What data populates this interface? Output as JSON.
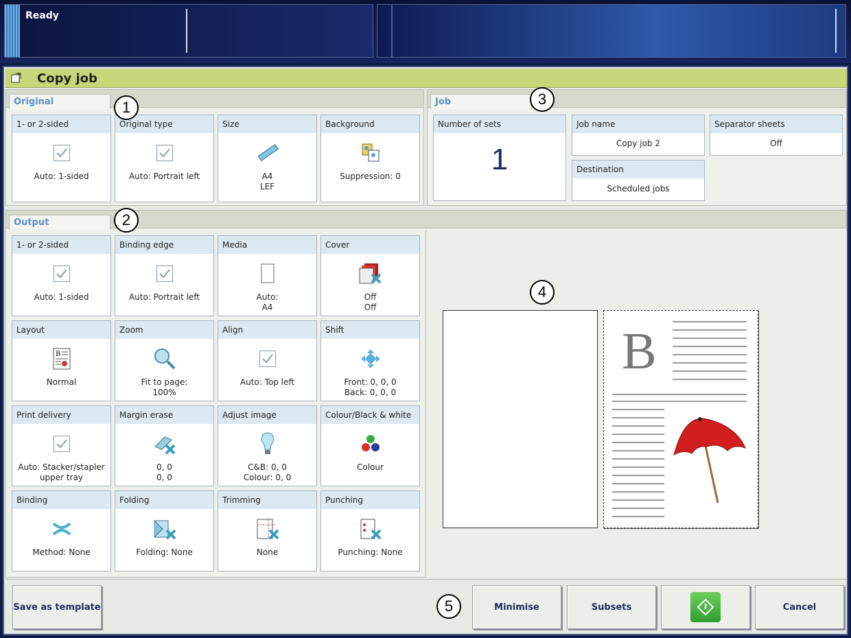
{
  "status": {
    "text": "Ready"
  },
  "window": {
    "title": "Copy job"
  },
  "original": {
    "tab": "Original",
    "tiles": [
      {
        "label": "1- or 2-sided",
        "icon": "checkbox-icon",
        "value": "Auto: 1-sided"
      },
      {
        "label": "Original type",
        "icon": "checkbox-icon",
        "value": "Auto: Portrait left"
      },
      {
        "label": "Size",
        "icon": "ruler-icon",
        "value": "A4\nLEF"
      },
      {
        "label": "Background",
        "icon": "background-suppression-icon",
        "value": "Suppression: 0"
      }
    ]
  },
  "job": {
    "tab": "Job",
    "sets": {
      "label": "Number of sets",
      "value": "1"
    },
    "name": {
      "label": "Job name",
      "value": "Copy job 2"
    },
    "separator": {
      "label": "Separator sheets",
      "value": "Off"
    },
    "destination": {
      "label": "Destination",
      "value": "Scheduled jobs"
    }
  },
  "output": {
    "tab": "Output",
    "tiles": [
      {
        "label": "1- or 2-sided",
        "icon": "checkbox-icon",
        "value": "Auto: 1-sided"
      },
      {
        "label": "Binding edge",
        "icon": "checkbox-icon",
        "value": "Auto: Portrait left"
      },
      {
        "label": "Media",
        "icon": "paper-sheet-icon",
        "value": "Auto:\nA4"
      },
      {
        "label": "Cover",
        "icon": "cover-icon",
        "value": "Off\nOff"
      },
      {
        "label": "Layout",
        "icon": "layout-icon",
        "value": "Normal"
      },
      {
        "label": "Zoom",
        "icon": "magnifier-icon",
        "value": "Fit to page:\n100%"
      },
      {
        "label": "Align",
        "icon": "checkbox-icon",
        "value": "Auto: Top left"
      },
      {
        "label": "Shift",
        "icon": "shift-arrows-icon",
        "value": "Front: 0, 0, 0\nBack: 0, 0, 0"
      },
      {
        "label": "Print delivery",
        "icon": "checkbox-icon",
        "value": "Auto: Stacker/stapler\nupper tray"
      },
      {
        "label": "Margin erase",
        "icon": "eraser-icon",
        "value": "0, 0\n0, 0"
      },
      {
        "label": "Adjust image",
        "icon": "lightbulb-icon",
        "value": "C&B: 0, 0\nColour: 0, 0"
      },
      {
        "label": "Colour/Black & white",
        "icon": "colour-dots-icon",
        "value": "Colour"
      },
      {
        "label": "Binding",
        "icon": "binding-icon",
        "value": "Method: None"
      },
      {
        "label": "Folding",
        "icon": "folding-icon",
        "value": "Folding: None"
      },
      {
        "label": "Trimming",
        "icon": "trimming-icon",
        "value": "None"
      },
      {
        "label": "Punching",
        "icon": "punching-icon",
        "value": "Punching: None"
      }
    ]
  },
  "markers": [
    "1",
    "2",
    "3",
    "4",
    "5"
  ],
  "preview": {
    "letter": "B"
  },
  "footer": {
    "save_template": "Save as template",
    "minimise": "Minimise",
    "subsets": "Subsets",
    "cancel": "Cancel"
  },
  "colors": {
    "title_bar": "#c8d67a",
    "tab_text": "#5b8fc8",
    "start_button": "#3aaa3a"
  }
}
